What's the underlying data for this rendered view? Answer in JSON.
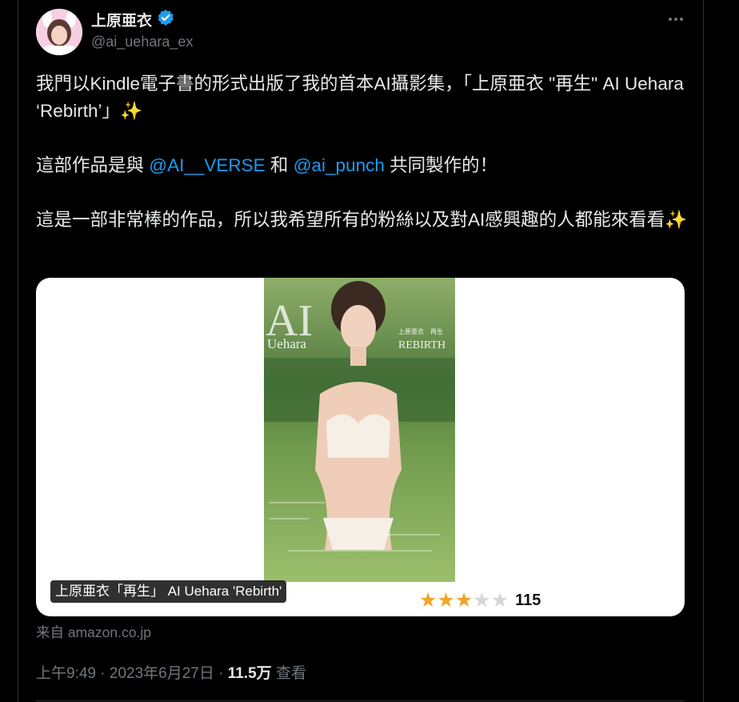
{
  "author": {
    "display_name": "上原亜衣",
    "handle": "@ai_uehara_ex",
    "verified": true
  },
  "tweet": {
    "line1_text": "我門以Kindle電子書的形式出版了我的首本AI攝影集，「上原亜衣 \"再生\" AI Uehara ‘Rebirth’」",
    "sparkle": "✨",
    "line2_prefix": "這部作品是與 ",
    "mention1": "@AI__VERSE",
    "line2_and": " 和 ",
    "mention2": "@ai_punch",
    "line2_suffix": " 共同製作的！",
    "line3_text": "這是一部非常棒的作品，所以我希望所有的粉絲以及對AI感興趣的人都能來看看"
  },
  "card": {
    "title": "上原亜衣「再生」 AI Uehara 'Rebirth'",
    "cover_big": "AI",
    "cover_left": "Uehara",
    "cover_right": "REBIRTH",
    "cover_jp": "上原亜衣　再生",
    "rating_stars": 3,
    "rating_max": 5,
    "rating_count": "115"
  },
  "source": "来自 amazon.co.jp",
  "meta": {
    "time": "上午9:49",
    "sep": "·",
    "date": "2023年6月27日",
    "views": "11.5万",
    "views_label": "查看"
  },
  "colors": {
    "background": "#000000",
    "link": "#1d9bf0",
    "muted": "#71767b",
    "verified": "#1d9bf0",
    "star": "#f0a52a"
  }
}
